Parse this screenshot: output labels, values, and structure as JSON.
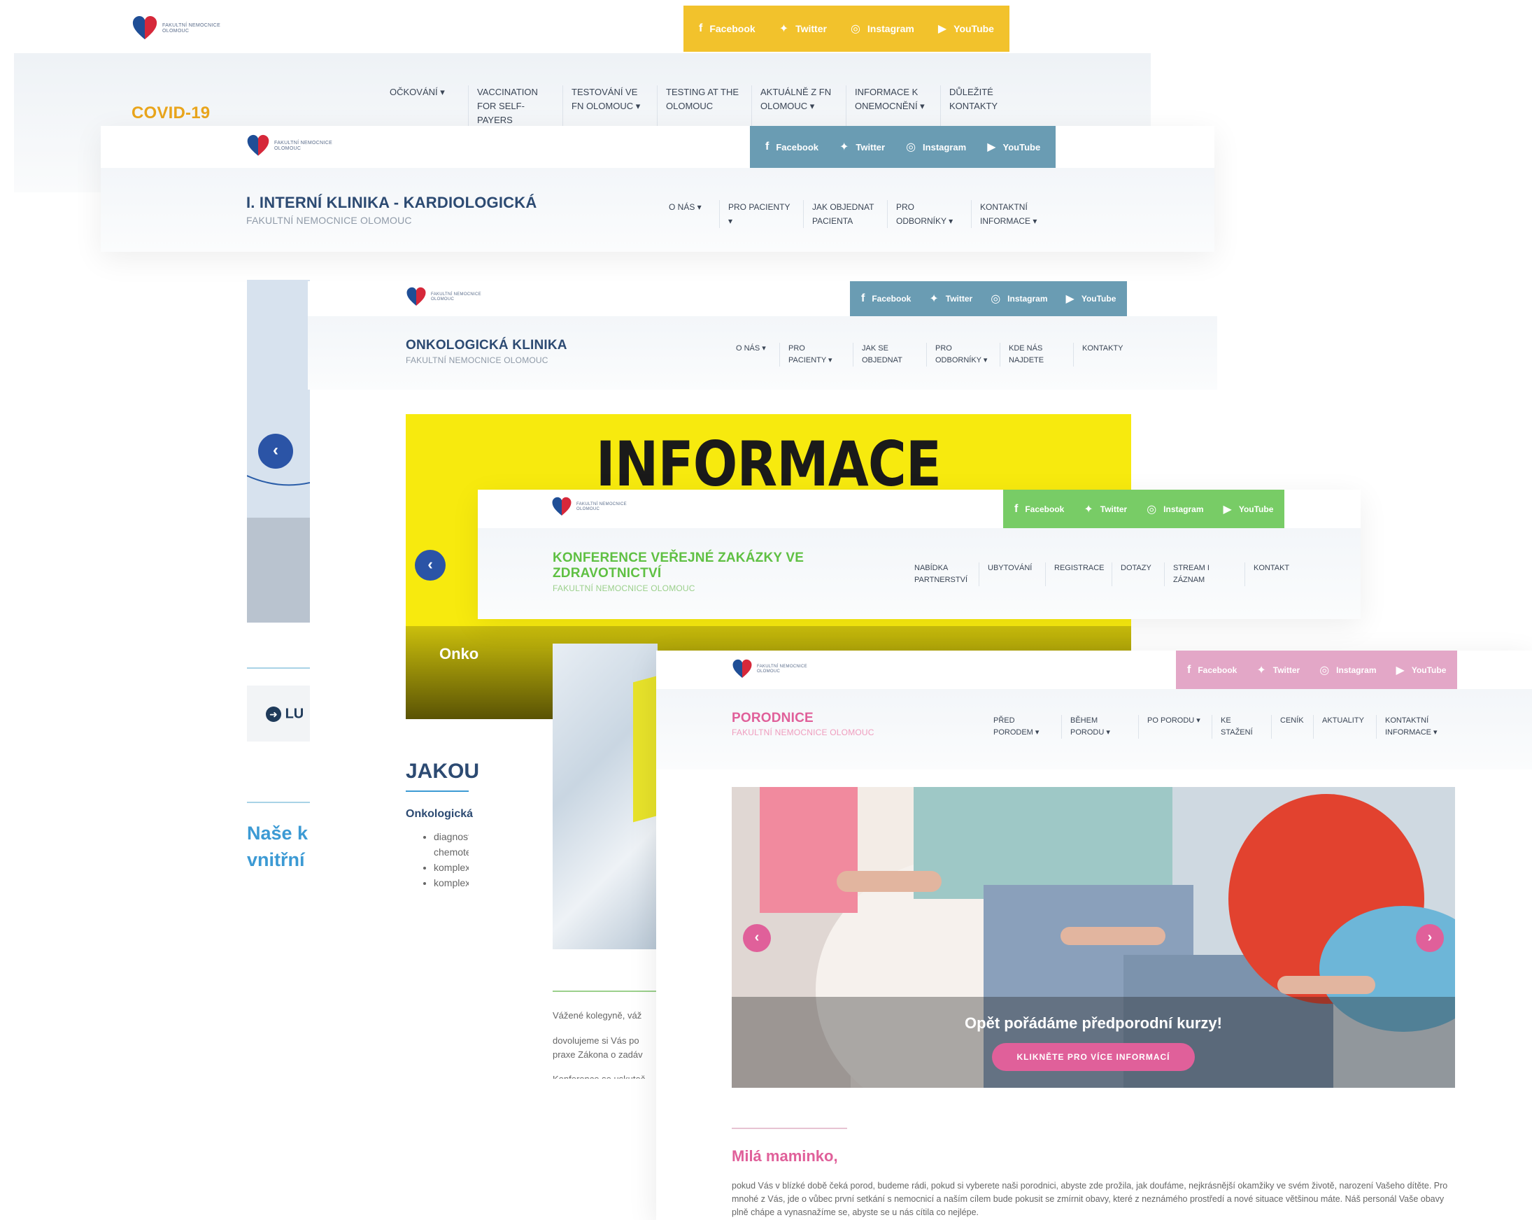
{
  "social": {
    "facebook": "Facebook",
    "twitter": "Twitter",
    "instagram": "Instagram",
    "youtube": "YouTube"
  },
  "logo_text": "FAKULTNÍ NEMOCNICE OLOMOUC",
  "covid": {
    "title": "COVID-19",
    "nav": [
      "OČKOVÁNÍ ▾",
      "VACCINATION FOR SELF-PAYERS",
      "TESTOVÁNÍ VE FN OLOMOUC ▾",
      "TESTING AT THE OLOMOUC",
      "AKTUÁLNĚ Z FN OLOMOUC ▾",
      "INFORMACE K ONEMOCNĚNÍ ▾",
      "DŮLEŽITÉ KONTAKTY"
    ],
    "accent": "#f2c22c"
  },
  "kardio": {
    "title": "I. INTERNÍ KLINIKA - KARDIOLOGICKÁ",
    "subtitle": "FAKULTNÍ NEMOCNICE OLOMOUC",
    "nav": [
      "O NÁS ▾",
      "PRO PACIENTY ▾",
      "JAK OBJEDNAT PACIENTA",
      "PRO ODBORNÍKY ▾",
      "KONTAKTNÍ INFORMACE ▾"
    ],
    "button": "LU",
    "heading": "Naše k vnitřní",
    "accent": "#4a8aa8"
  },
  "onko": {
    "title": "ONKOLOGICKÁ KLINIKA",
    "subtitle": "FAKULTNÍ NEMOCNICE OLOMOUC",
    "nav": [
      "O NÁS ▾",
      "PRO PACIENTY ▾",
      "JAK SE OBJEDNAT",
      "PRO ODBORNÍKY ▾",
      "KDE NÁS NAJDETE",
      "KONTAKTY"
    ],
    "banner": "INFORMACE",
    "banner_caption": "Onko",
    "heading": "JAKOU",
    "subheading": "Onkologická",
    "list": [
      "diagnost chemote",
      "komplex",
      "komplex"
    ],
    "accent": "#4a8aa8"
  },
  "konf": {
    "title": "KONFERENCE VEŘEJNÉ ZAKÁZKY VE ZDRAVOTNICTVÍ",
    "subtitle": "FAKULTNÍ NEMOCNICE OLOMOUC",
    "nav": [
      "NABÍDKA PARTNERSTVÍ",
      "UBYTOVÁNÍ",
      "REGISTRACE",
      "DOTAZY",
      "STREAM I ZÁZNAM",
      "KONTAKT"
    ],
    "text1": "Vážené kolegyně, váž",
    "text2": "dovolujeme si Vás po praxe Zákona o zadáv",
    "text3": "Konference se uskuteč",
    "accent": "#5fc043"
  },
  "porod": {
    "title": "PORODNICE",
    "subtitle": "FAKULTNÍ NEMOCNICE OLOMOUC",
    "nav": [
      "PŘED PORODEM ▾",
      "BĚHEM PORODU ▾",
      "PO PORODU ▾",
      "KE STAŽENÍ",
      "CENÍK",
      "AKTUALITY",
      "KONTAKTNÍ INFORMACE ▾"
    ],
    "hero_caption": "Opět pořádáme předporodní kurzy!",
    "hero_button": "KLIKNĚTE PRO VÍCE INFORMACÍ",
    "greeting": "Milá maminko,",
    "para": "pokud Vás v blízké době čeká porod, budeme rádi, pokud si vyberete naši porodnici, abyste zde prožila, jak doufáme, nejkrásnější okamžiky ve svém životě, narození Vašeho dítěte. Pro mnohé z Vás, jde o vůbec první setkání s nemocnicí a naším cílem bude pokusit se zmírnit obavy, které z neznámého prostředí a nové situace většinou máte. Náš personál Vaše obavy plně chápe a vynasnažíme se, abyste se u nás cítila co nejlépe.",
    "accent": "#e0609a",
    "social_bg": "#e3a7c7"
  }
}
